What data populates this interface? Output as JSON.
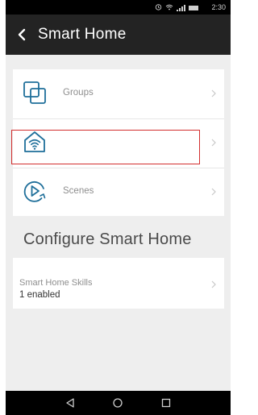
{
  "status_bar": {
    "time": "2:30"
  },
  "header": {
    "title": "Smart Home"
  },
  "main_list": {
    "items": [
      {
        "label": "Groups",
        "icon": "groups-icon"
      },
      {
        "label": "",
        "icon": "home-wifi-icon"
      },
      {
        "label": "Scenes",
        "icon": "scenes-play-icon"
      }
    ]
  },
  "section": {
    "title": "Configure Smart Home"
  },
  "skills": {
    "title": "Smart Home Skills",
    "subtitle": "1 enabled"
  },
  "colors": {
    "accent": "#1f6f9a",
    "app_bar": "#232323",
    "highlight": "#d22f2f"
  }
}
